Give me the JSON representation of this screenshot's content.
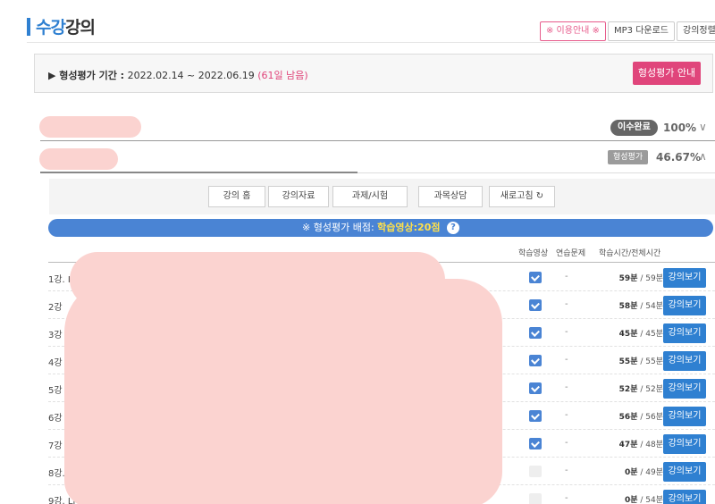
{
  "header": {
    "title_accent": "수강",
    "title_rest": "강의",
    "guide_button": "※ 이용안내 ※",
    "mp3_button": "MP3 다운로드",
    "sort_button": "강의정렬"
  },
  "period": {
    "label": "▶ 형성평가 기간 :",
    "range": "2022.02.14 ~ 2022.06.19",
    "remaining": "(61일 남음)",
    "button": "형성평가 안내"
  },
  "courses": [
    {
      "badge": "이수완료",
      "percent": "100%",
      "chevron": "∨"
    },
    {
      "badge": "형성평가",
      "percent": "46.67%",
      "chevron": "∧",
      "progress": 0.47
    }
  ],
  "tabs": [
    "강의 홈",
    "강의자료",
    "과제/시험",
    "과목상담",
    "새로고침"
  ],
  "notice": {
    "prefix": "※ 형성평가 배점:",
    "score": "학습영상:20점",
    "help": "?"
  },
  "columns": {
    "video": "학습영상",
    "practice": "연습문제",
    "time": "학습시간/전체시간"
  },
  "lectures": [
    {
      "title": "1강. I",
      "checked": true,
      "practice": "-",
      "studied": "59분",
      "total": "/ 59분",
      "button": "강의보기"
    },
    {
      "title": "2강",
      "checked": true,
      "practice": "-",
      "studied": "58분",
      "total": "/ 54분",
      "button": "강의보기"
    },
    {
      "title": "3강",
      "checked": true,
      "practice": "-",
      "studied": "45분",
      "total": "/ 45분",
      "button": "강의보기"
    },
    {
      "title": "4강",
      "checked": true,
      "practice": "-",
      "studied": "55분",
      "total": "/ 55분",
      "button": "강의보기"
    },
    {
      "title": "5강",
      "checked": true,
      "practice": "-",
      "studied": "52분",
      "total": "/ 52분",
      "button": "강의보기"
    },
    {
      "title": "6강",
      "checked": true,
      "practice": "-",
      "studied": "56분",
      "total": "/ 56분",
      "button": "강의보기"
    },
    {
      "title": "7강",
      "checked": true,
      "practice": "-",
      "studied": "47분",
      "total": "/ 48분",
      "button": "강의보기"
    },
    {
      "title": "8강.",
      "checked": false,
      "practice": "-",
      "studied": "0분",
      "total": "/ 49분",
      "button": "강의보기"
    },
    {
      "title": "9강. Li",
      "checked": false,
      "practice": "-",
      "studied": "0분",
      "total": "/ 54분",
      "button": "강의보기"
    }
  ]
}
